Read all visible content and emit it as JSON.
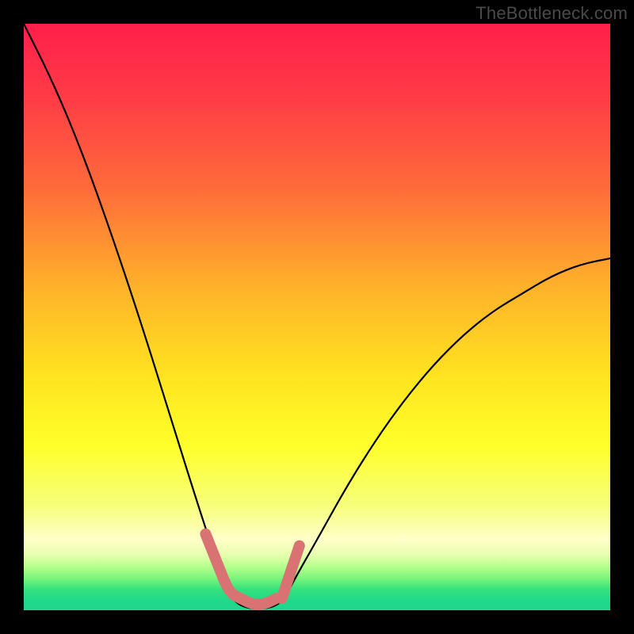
{
  "watermark": "TheBottleneck.com",
  "colors": {
    "frame": "#000000",
    "curve": "#000000",
    "marker": "#d97373",
    "gradient_stops": [
      {
        "offset": 0.0,
        "color": "#ff1f4b"
      },
      {
        "offset": 0.12,
        "color": "#ff3a47"
      },
      {
        "offset": 0.28,
        "color": "#ff6b3a"
      },
      {
        "offset": 0.45,
        "color": "#ffb22a"
      },
      {
        "offset": 0.6,
        "color": "#ffe31f"
      },
      {
        "offset": 0.72,
        "color": "#ffff2a"
      },
      {
        "offset": 0.82,
        "color": "#f7ff7a"
      },
      {
        "offset": 0.88,
        "color": "#ffffc8"
      },
      {
        "offset": 0.905,
        "color": "#e6ffb0"
      },
      {
        "offset": 0.925,
        "color": "#b8ff8e"
      },
      {
        "offset": 0.945,
        "color": "#7cf57c"
      },
      {
        "offset": 0.965,
        "color": "#33e07e"
      },
      {
        "offset": 0.985,
        "color": "#1fd98a"
      },
      {
        "offset": 1.0,
        "color": "#1fd68e"
      }
    ]
  },
  "chart_data": {
    "type": "line",
    "title": "",
    "xlabel": "",
    "ylabel": "",
    "xlim": [
      0,
      100
    ],
    "ylim": [
      0,
      100
    ],
    "grid": false,
    "description": "Bottleneck percentage curve. X-axis sweeps a component choice; Y-axis is bottleneck percent (0 at bottom, ~100 at top). The curve drops from top-left to a flat minimum near x≈35–45 (~0%), then rises to ~60% at the right edge. Short pink segments highlight the two knees where the curve meets the green near-zero band.",
    "series": [
      {
        "name": "bottleneck-curve",
        "x": [
          0,
          5,
          10,
          15,
          20,
          25,
          30,
          34,
          36,
          40,
          44,
          46,
          50,
          55,
          60,
          65,
          70,
          75,
          80,
          85,
          90,
          95,
          100
        ],
        "y": [
          100,
          90,
          78,
          64,
          49,
          33,
          17,
          5,
          1,
          0,
          1,
          5,
          12,
          21,
          29,
          36,
          42,
          47,
          51,
          54,
          57,
          59,
          60
        ]
      }
    ],
    "highlight_segments": [
      {
        "name": "knee-left",
        "x": [
          31,
          33,
          35,
          37
        ],
        "y": [
          13,
          8,
          3,
          2
        ]
      },
      {
        "name": "flat-bottom",
        "x": [
          37,
          39,
          41,
          43
        ],
        "y": [
          2,
          1,
          1,
          2
        ]
      },
      {
        "name": "knee-right",
        "x": [
          44,
          45,
          46,
          47
        ],
        "y": [
          2,
          5,
          8,
          11
        ]
      }
    ]
  }
}
